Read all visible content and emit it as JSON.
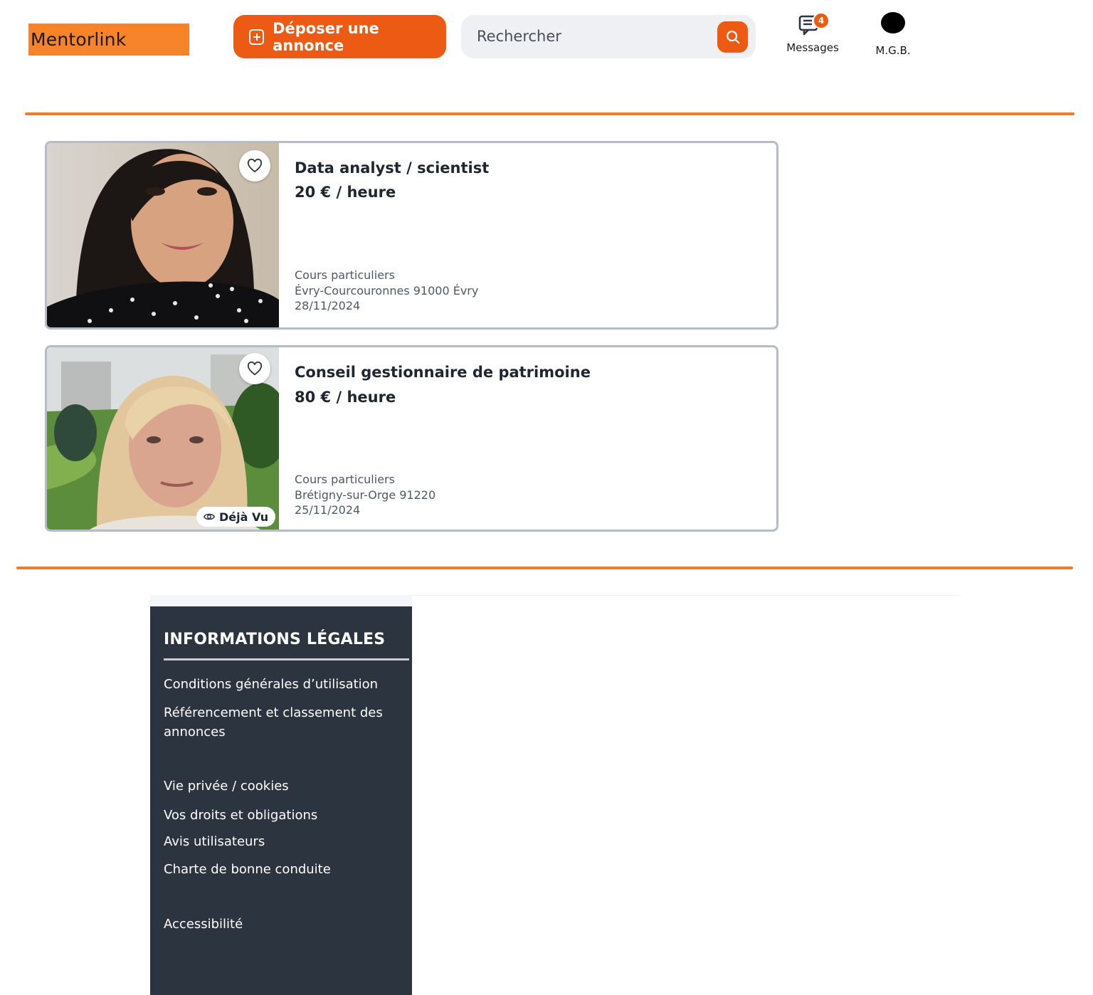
{
  "header": {
    "logo_text": "Mentorlink",
    "post_button_label": "Déposer une annonce",
    "search_placeholder": "Rechercher",
    "messages_label": "Messages",
    "messages_count": "4",
    "user_label": "M.G.B."
  },
  "listings": [
    {
      "title": "Data analyst / scientist",
      "price": "20 € / heure",
      "category": "Cours particuliers",
      "location": "Évry-Courcouronnes 91000 Évry",
      "date": "28/11/2024",
      "seen_label": ""
    },
    {
      "title": "Conseil gestionnaire de patrimoine",
      "price": "80 € / heure",
      "category": "Cours particuliers",
      "location": "Brétigny-sur-Orge 91220",
      "date": "25/11/2024",
      "seen_label": "Déjà Vu"
    }
  ],
  "footer": {
    "legal_title": "INFORMATIONS LÉGALES",
    "links": [
      "Conditions générales d’utilisation",
      "Référencement et classement des annonces",
      "Vie privée / cookies",
      "Vos droits et obligations",
      "Avis utilisateurs",
      "Charte de bonne conduite",
      "Accessibilité"
    ]
  },
  "colors": {
    "brand_orange": "#ec5a13",
    "logo_bg": "#f7832b",
    "rule_orange": "#f07d2d",
    "footer_bg": "#2c3440"
  }
}
